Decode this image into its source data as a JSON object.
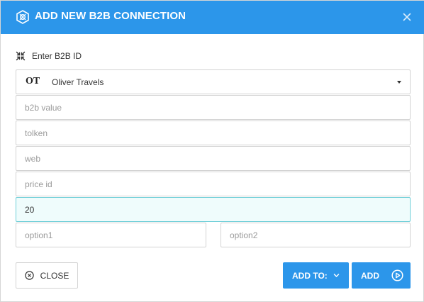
{
  "dialog": {
    "title": "ADD NEW B2B CONNECTION",
    "brand_color": "#2c96ea"
  },
  "form": {
    "id_label": "Enter B2B ID",
    "select": {
      "code": "OT",
      "value": "Oliver Travels"
    },
    "fields": [
      {
        "name": "b2b-value",
        "value": "",
        "placeholder": "b2b value"
      },
      {
        "name": "tolken",
        "value": "",
        "placeholder": "tolken"
      },
      {
        "name": "web",
        "value": "",
        "placeholder": "web"
      },
      {
        "name": "price-id",
        "value": "",
        "placeholder": "price id"
      },
      {
        "name": "quantity",
        "value": "20",
        "placeholder": ""
      },
      {
        "name": "option1",
        "value": "",
        "placeholder": "option1"
      },
      {
        "name": "option2",
        "value": "",
        "placeholder": "option2"
      }
    ]
  },
  "footer": {
    "close_label": "CLOSE",
    "add_to_label": "ADD TO:",
    "add_label": "ADD"
  },
  "icons": {
    "header": "hexagon-logo-icon",
    "close": "close-icon",
    "id_label": "compress-arrows-icon",
    "close_button": "circle-x-icon",
    "add_to": "chevron-down-icon",
    "add": "play-circle-icon"
  }
}
